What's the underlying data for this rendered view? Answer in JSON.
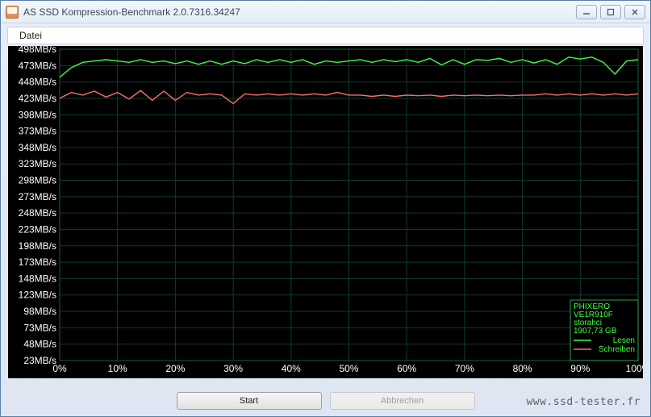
{
  "window": {
    "title": "AS SSD Kompression-Benchmark 2.0.7316.34247"
  },
  "menu": {
    "file": "Datei"
  },
  "buttons": {
    "start": "Start",
    "abort": "Abbrechen"
  },
  "watermark": "www.ssd-tester.fr",
  "legend": {
    "device": "PHIXERO",
    "model": "VE1R910F",
    "driver": "storahci",
    "capacity": "1907,73 GB",
    "read": "Lesen",
    "write": "Schreiben"
  },
  "chart_data": {
    "type": "line",
    "xlabel": "",
    "ylabel": "",
    "x_unit": "%",
    "y_unit": "MB/s",
    "xlim": [
      0,
      100
    ],
    "ylim": [
      23,
      498
    ],
    "y_ticks": [
      23,
      48,
      73,
      98,
      123,
      148,
      173,
      198,
      223,
      248,
      273,
      298,
      323,
      348,
      373,
      398,
      423,
      448,
      473,
      498
    ],
    "x_ticks": [
      0,
      10,
      20,
      30,
      40,
      50,
      60,
      70,
      80,
      90,
      100
    ],
    "x": [
      0,
      2,
      4,
      6,
      8,
      10,
      12,
      14,
      16,
      18,
      20,
      22,
      24,
      26,
      28,
      30,
      32,
      34,
      36,
      38,
      40,
      42,
      44,
      46,
      48,
      50,
      52,
      54,
      56,
      58,
      60,
      62,
      64,
      66,
      68,
      70,
      72,
      74,
      76,
      78,
      80,
      82,
      84,
      86,
      88,
      90,
      92,
      94,
      96,
      98,
      100
    ],
    "series": [
      {
        "name": "Lesen",
        "color": "#3dff3d",
        "values": [
          455,
          470,
          478,
          480,
          482,
          480,
          478,
          482,
          478,
          480,
          476,
          480,
          475,
          480,
          475,
          480,
          476,
          482,
          478,
          482,
          478,
          482,
          475,
          480,
          478,
          480,
          482,
          478,
          482,
          479,
          482,
          478,
          484,
          474,
          482,
          475,
          482,
          481,
          484,
          478,
          482,
          477,
          482,
          475,
          486,
          483,
          486,
          478,
          460,
          480,
          482
        ]
      },
      {
        "name": "Schreiben",
        "color": "#ff6e6e",
        "values": [
          423,
          432,
          428,
          434,
          425,
          432,
          422,
          435,
          420,
          434,
          420,
          432,
          428,
          430,
          428,
          415,
          430,
          428,
          430,
          428,
          430,
          428,
          430,
          428,
          432,
          428,
          428,
          426,
          428,
          426,
          428,
          427,
          428,
          426,
          428,
          427,
          428,
          427,
          428,
          427,
          428,
          428,
          430,
          428,
          430,
          428,
          430,
          428,
          430,
          428,
          430
        ]
      }
    ]
  }
}
